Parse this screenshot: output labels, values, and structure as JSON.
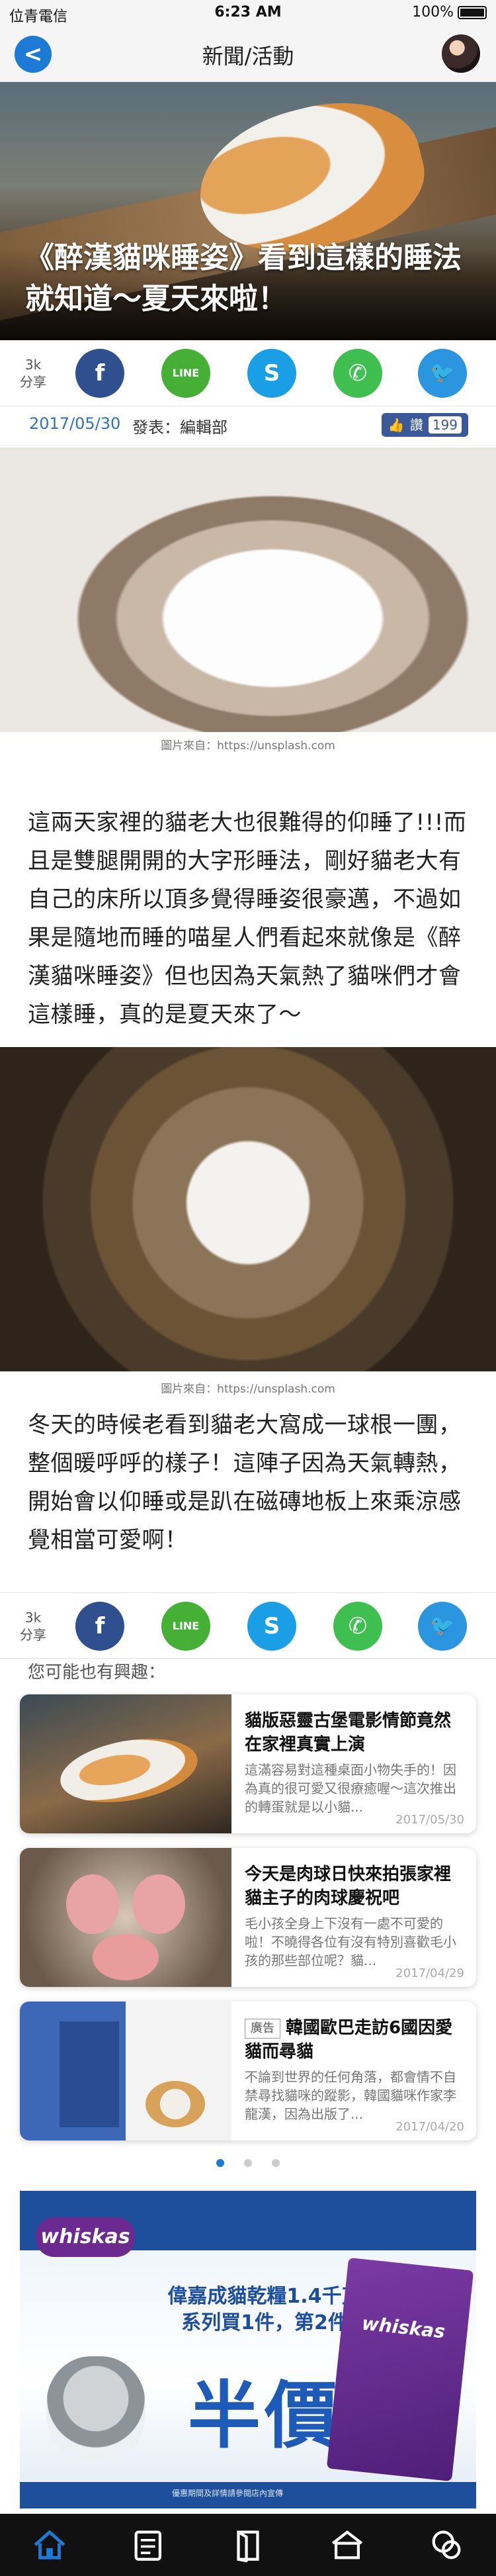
{
  "status": {
    "carrier": "位青電信",
    "time": "6:23 AM",
    "battery": "100%"
  },
  "nav": {
    "title": "新聞/活動",
    "back_label": "<"
  },
  "article": {
    "title": "《醉漢貓咪睡姿》看到這樣的睡法就知道～夏天來啦！",
    "date": "2017/05/30",
    "author": "發表：編輯部",
    "like_label": "讚",
    "like_count": "199",
    "paragraph1": "這兩天家裡的貓老大也很難得的仰睡了!!!而且是雙腿開開的大字形睡法，剛好貓老大有自己的床所以頂多覺得睡姿很豪邁，不過如果是隨地而睡的喵星人們看起來就像是《醉漢貓咪睡姿》但也因為天氣熱了貓咪們才會這樣睡，真的是夏天來了～",
    "caption1": "圖片來自：https://unsplash.com",
    "paragraph2": "冬天的時候老看到貓老大窩成一球根一團，整個暖呼呼的樣子！這陣子因為天氣轉熱，開始會以仰睡或是趴在磁磚地板上來乘涼感覺相當可愛啊！",
    "caption2": "圖片來自：https://unsplash.com"
  },
  "share": {
    "count": "3k",
    "count_label": "分享",
    "buttons": [
      {
        "name": "facebook",
        "glyph": "f",
        "color": "#2f4f8e"
      },
      {
        "name": "line",
        "glyph": "LINE",
        "color": "#45b035"
      },
      {
        "name": "skype",
        "glyph": "S",
        "color": "#1a9ee6"
      },
      {
        "name": "whatsapp",
        "glyph": "✆",
        "color": "#3fbf4f"
      },
      {
        "name": "twitter",
        "glyph": "🐦",
        "color": "#2c95e0"
      }
    ]
  },
  "related": {
    "heading": "您可能也有興趣：",
    "items": [
      {
        "title": "貓版惡靈古堡電影情節竟然在家裡真實上演",
        "desc": "這滿容易對這種桌面小物失手的！因為真的很可愛又很療癒喔～這次推出的轉蛋就是以小貓...",
        "date": "2017/05/30",
        "ad": ""
      },
      {
        "title": "今天是肉球日快來拍張家裡貓主子的肉球慶祝吧",
        "desc": "毛小孩全身上下沒有一處不可愛的啦！不曉得各位有沒有特別喜歡毛小孩的那些部位呢？貓...",
        "date": "2017/04/29",
        "ad": ""
      },
      {
        "title": "韓國歐巴走訪6國因愛貓而尋貓",
        "desc": "不論到世界的任何角落，都會情不自禁尋找貓咪的蹤影，韓國貓咪作家李龍漢，因為出版了...",
        "date": "2017/04/20",
        "ad": "廣告"
      }
    ]
  },
  "ad_banner": {
    "brand": "whiskas",
    "headline": "偉嘉成貓乾糧1.4千克系列買1件，第2件",
    "highlight": "半價",
    "bag_brand": "whiskas",
    "footnote": "優惠期間及詳情請參閱店內宣傳"
  },
  "tabs": [
    {
      "name": "home-icon",
      "active": true
    },
    {
      "name": "news-icon",
      "active": false
    },
    {
      "name": "book-icon",
      "active": false
    },
    {
      "name": "shop-icon",
      "active": false
    },
    {
      "name": "chat-icon",
      "active": false
    }
  ],
  "colors": {
    "accent": "#1d7bd6",
    "date_blue": "#2a72c4"
  }
}
